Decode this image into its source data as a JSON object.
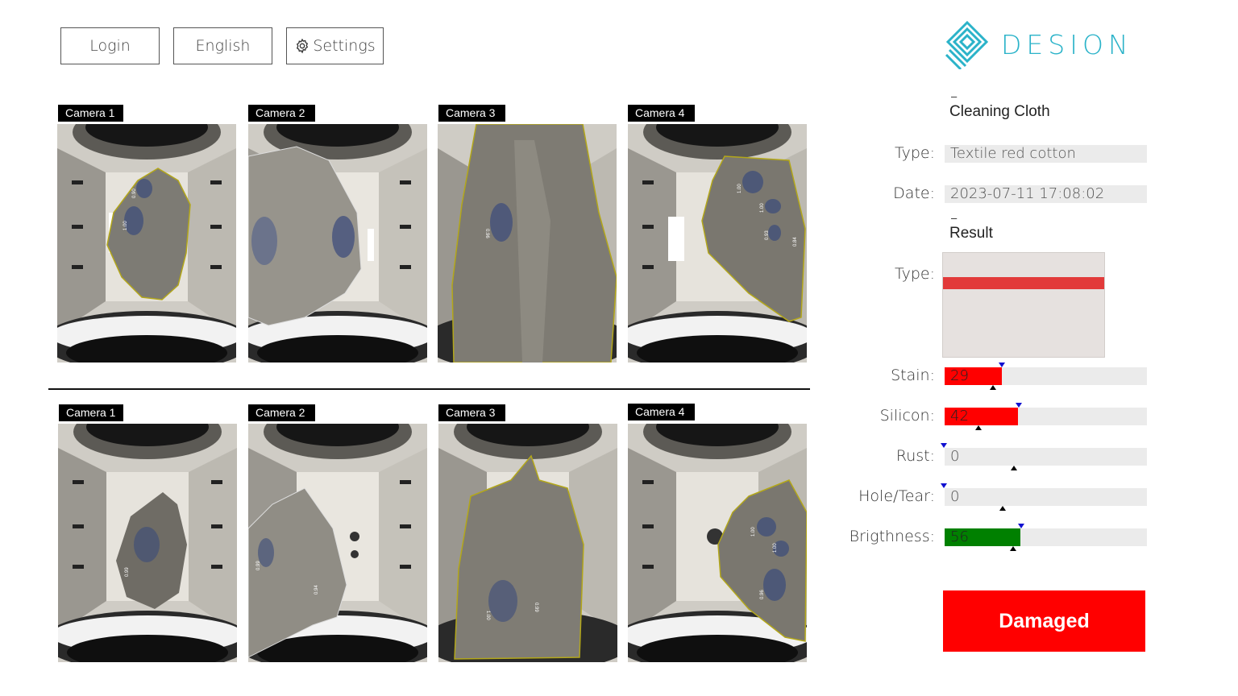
{
  "toolbar": {
    "login_label": "Login",
    "language_label": "English",
    "settings_label": "Settings"
  },
  "brand": {
    "name": "DESION",
    "color": "#2bb3c9"
  },
  "cameras": {
    "top": [
      {
        "label": "Camera 1",
        "scores": [
          "0.90",
          "1.00"
        ]
      },
      {
        "label": "Camera 2",
        "scores": []
      },
      {
        "label": "Camera 3",
        "scores": [
          "0.96"
        ]
      },
      {
        "label": "Camera 4",
        "scores": [
          "1.00",
          "1.00",
          "0.93",
          "0.84"
        ]
      }
    ],
    "bottom": [
      {
        "label": "Camera 1",
        "scores": [
          "0.99"
        ]
      },
      {
        "label": "Camera 2",
        "scores": [
          "0.99",
          "0.94"
        ]
      },
      {
        "label": "Camera 3",
        "scores": [
          "1.00",
          "0.99"
        ]
      },
      {
        "label": "Camera 4",
        "scores": [
          "1.00",
          "1.00",
          "0.96"
        ]
      }
    ]
  },
  "info": {
    "title": "Cleaning Cloth",
    "dash": "–",
    "type_label": "Type:",
    "type_value": "Textile red cotton",
    "date_label": "Date:",
    "date_value": "2023-07-11 17:08:02"
  },
  "result": {
    "title": "Result",
    "dash": "–",
    "type_label": "Type:",
    "bars": [
      {
        "label": "Stain:",
        "value": 29,
        "display": "29",
        "color": "#ff0000"
      },
      {
        "label": "Silicon:",
        "value": 42,
        "display": "42",
        "color": "#ff0000"
      },
      {
        "label": "Rust:",
        "value": 0,
        "display": "0",
        "color": "#ff0000"
      },
      {
        "label": "Hole/Tear:",
        "value": 0,
        "display": "0",
        "color": "#ff0000"
      },
      {
        "label": "Brigthness:",
        "value": 56,
        "display": "56",
        "color": "#008000"
      }
    ],
    "verdict": "Damaged",
    "verdict_color": "#ff0000"
  }
}
